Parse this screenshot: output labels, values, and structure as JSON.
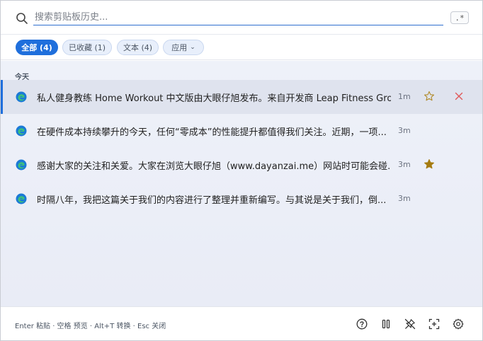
{
  "search": {
    "placeholder": "搜索剪贴板历史...",
    "regex_label": ".*"
  },
  "filters": [
    {
      "label": "全部 (4)",
      "active": true
    },
    {
      "label": "已收藏 (1)",
      "active": false
    },
    {
      "label": "文本 (4)",
      "active": false
    },
    {
      "label": "应用",
      "active": false,
      "caret": "⌄"
    }
  ],
  "group": {
    "label": "今天"
  },
  "items": [
    {
      "text": "私人健身教练 Home Workout 中文版由大眼仔旭发布。来自开发商 Leap Fitness Grou...",
      "time": "1m",
      "starred": false,
      "app_icon": "edge-browser-icon"
    },
    {
      "text": "在硬件成本持续攀升的今天，任何“零成本”的性能提升都值得我们关注。近期，一项...",
      "time": "3m",
      "starred": false,
      "app_icon": "edge-browser-icon"
    },
    {
      "text": "感谢大家的关注和关爱。大家在浏览大眼仔旭（www.dayanzai.me）网站时可能会碰...",
      "time": "3m",
      "starred": true,
      "app_icon": "edge-browser-icon"
    },
    {
      "text": "时隔八年，我把这篇关于我们的内容进行了整理并重新编写。与其说是关于我们，倒...",
      "time": "3m",
      "starred": false,
      "app_icon": "edge-browser-icon"
    }
  ],
  "footer": {
    "hint": "Enter 粘贴 · 空格 预览 · Alt+T 转换 · Esc 关闭",
    "icons": [
      "help-icon",
      "pause-icon",
      "unpin-icon",
      "screenshot-icon",
      "settings-icon"
    ]
  },
  "colors": {
    "accent": "#1f6fdc",
    "star": "#a57b10",
    "close": "#e05a5a"
  }
}
